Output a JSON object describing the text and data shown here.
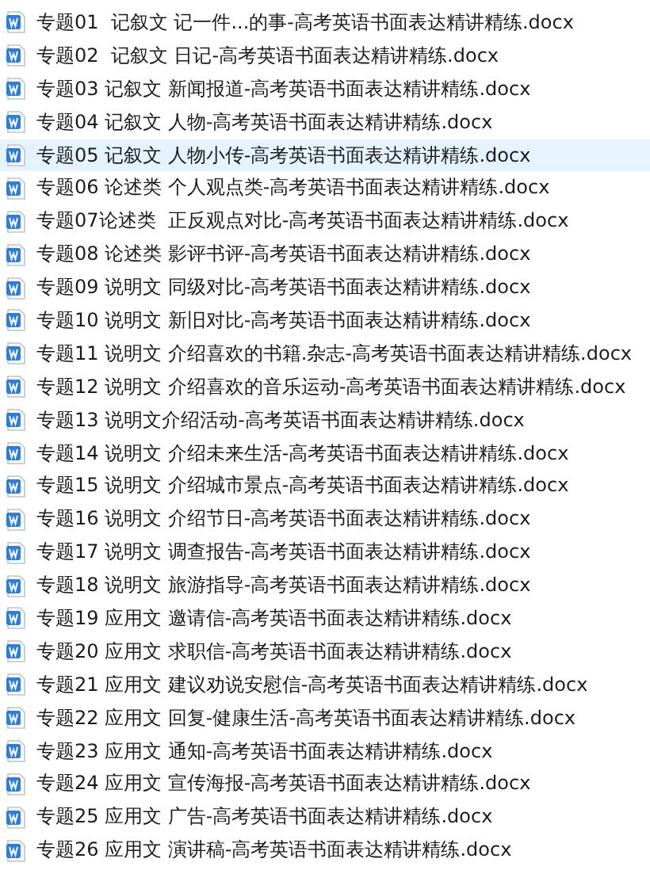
{
  "files": [
    {
      "name": "专题01  记叙文 记一件...的事-高考英语书面表达精讲精练.docx",
      "selected": false
    },
    {
      "name": "专题02  记叙文 日记-高考英语书面表达精讲精练.docx",
      "selected": false
    },
    {
      "name": "专题03 记叙文 新闻报道-高考英语书面表达精讲精练.docx",
      "selected": false
    },
    {
      "name": "专题04 记叙文 人物-高考英语书面表达精讲精练.docx",
      "selected": false
    },
    {
      "name": "专题05 记叙文 人物小传-高考英语书面表达精讲精练.docx",
      "selected": true
    },
    {
      "name": "专题06 论述类 个人观点类-高考英语书面表达精讲精练.docx",
      "selected": false
    },
    {
      "name": "专题07论述类  正反观点对比-高考英语书面表达精讲精练.docx",
      "selected": false
    },
    {
      "name": "专题08 论述类 影评书评-高考英语书面表达精讲精练.docx",
      "selected": false
    },
    {
      "name": "专题09 说明文 同级对比-高考英语书面表达精讲精练.docx",
      "selected": false
    },
    {
      "name": "专题10 说明文 新旧对比-高考英语书面表达精讲精练.docx",
      "selected": false
    },
    {
      "name": "专题11 说明文 介绍喜欢的书籍.杂志-高考英语书面表达精讲精练.docx",
      "selected": false
    },
    {
      "name": "专题12 说明文 介绍喜欢的音乐运动-高考英语书面表达精讲精练.docx",
      "selected": false
    },
    {
      "name": "专题13 说明文介绍活动-高考英语书面表达精讲精练.docx",
      "selected": false
    },
    {
      "name": "专题14 说明文 介绍未来生活-高考英语书面表达精讲精练.docx",
      "selected": false
    },
    {
      "name": "专题15 说明文 介绍城市景点-高考英语书面表达精讲精练.docx",
      "selected": false
    },
    {
      "name": "专题16 说明文 介绍节日-高考英语书面表达精讲精练.docx",
      "selected": false
    },
    {
      "name": "专题17 说明文 调查报告-高考英语书面表达精讲精练.docx",
      "selected": false
    },
    {
      "name": "专题18 说明文 旅游指导-高考英语书面表达精讲精练.docx",
      "selected": false
    },
    {
      "name": "专题19 应用文 邀请信-高考英语书面表达精讲精练.docx",
      "selected": false
    },
    {
      "name": "专题20 应用文 求职信-高考英语书面表达精讲精练.docx",
      "selected": false
    },
    {
      "name": "专题21 应用文 建议劝说安慰信-高考英语书面表达精讲精练.docx",
      "selected": false
    },
    {
      "name": "专题22 应用文 回复-健康生活-高考英语书面表达精讲精练.docx",
      "selected": false
    },
    {
      "name": "专题23 应用文 通知-高考英语书面表达精讲精练.docx",
      "selected": false
    },
    {
      "name": "专题24 应用文 宣传海报-高考英语书面表达精讲精练.docx",
      "selected": false
    },
    {
      "name": "专题25 应用文 广告-高考英语书面表达精讲精练.docx",
      "selected": false
    },
    {
      "name": "专题26 应用文 演讲稿-高考英语书面表达精讲精练.docx",
      "selected": false
    }
  ]
}
